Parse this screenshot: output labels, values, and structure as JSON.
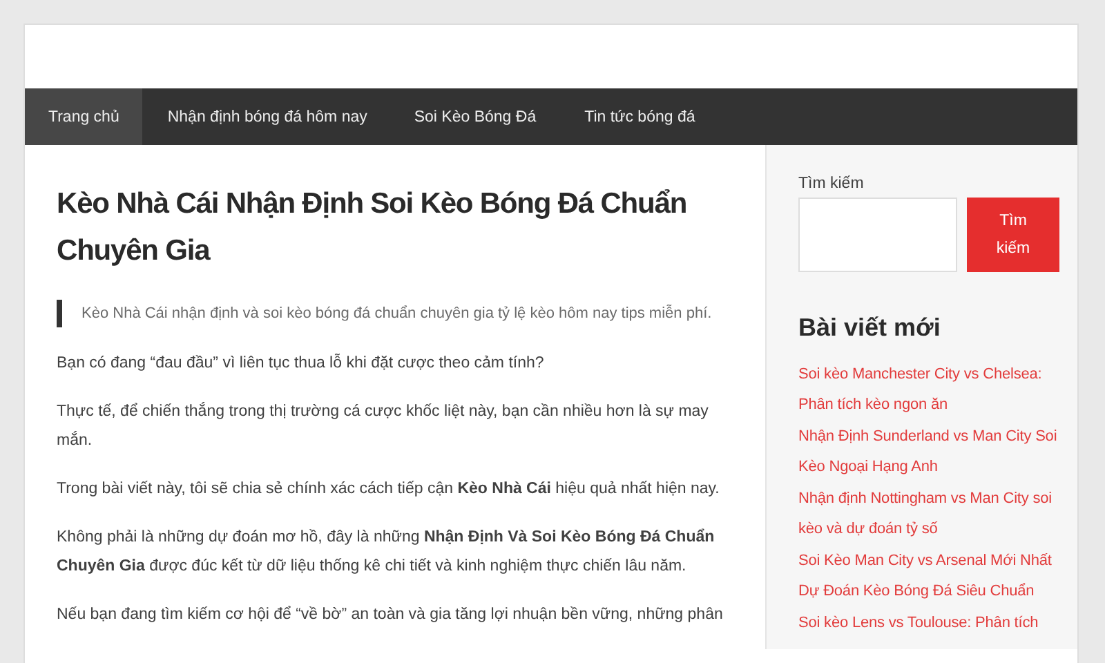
{
  "nav": [
    {
      "label": "Trang chủ",
      "selected": true
    },
    {
      "label": "Nhận định bóng đá hôm nay",
      "selected": false
    },
    {
      "label": "Soi Kèo Bóng Đá",
      "selected": false
    },
    {
      "label": "Tin tức bóng đá",
      "selected": false
    }
  ],
  "article": {
    "title": "Kèo Nhà Cái Nhận Định Soi Kèo Bóng Đá Chuẩn Chuyên Gia",
    "quote": "Kèo Nhà Cái nhận định và soi kèo bóng đá chuẩn chuyên gia tỷ lệ kèo hôm nay tips miễn phí.",
    "paragraphs": [
      "Bạn có đang “đau đầu” vì liên tục thua lỗ khi đặt cược theo cảm tính?",
      "Thực tế, để chiến thắng trong thị trường cá cược khốc liệt này, bạn cần nhiều hơn là sự may mắn.",
      "Trong bài viết này, tôi sẽ chia sẻ chính xác cách tiếp cận **Kèo Nhà Cái** hiệu quả nhất hiện nay.",
      "Không phải là những dự đoán mơ hồ, đây là những **Nhận Định Và Soi Kèo Bóng Đá Chuẩn Chuyên Gia** được đúc kết từ dữ liệu thống kê chi tiết và kinh nghiệm thực chiến lâu năm.",
      "Nếu bạn đang tìm kiếm cơ hội để “về bờ” an toàn và gia tăng lợi nhuận bền vững, những phân"
    ]
  },
  "sidebar": {
    "search_label": "Tìm kiếm",
    "search_button": "Tìm kiếm",
    "recent_title": "Bài viết mới",
    "recent_posts": [
      "Soi kèo Manchester City vs Chelsea: Phân tích kèo ngon ăn",
      "Nhận Định Sunderland vs Man City Soi Kèo Ngoại Hạng Anh",
      "Nhận định Nottingham vs Man City soi kèo và dự đoán tỷ số",
      "Soi Kèo Man City vs Arsenal Mới Nhất Dự Đoán Kèo Bóng Đá Siêu Chuẩn",
      "Soi kèo Lens vs Toulouse:   Phân tích"
    ]
  }
}
